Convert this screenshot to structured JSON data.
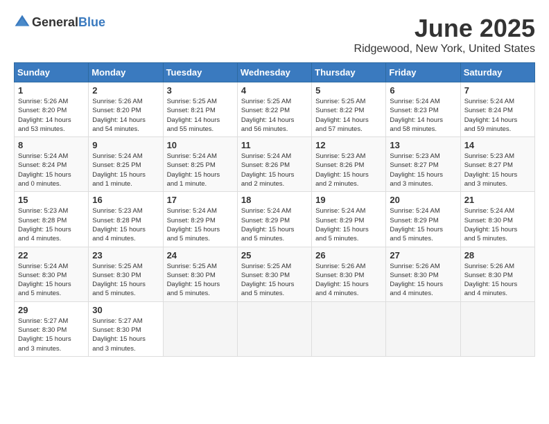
{
  "header": {
    "logo_general": "General",
    "logo_blue": "Blue",
    "title": "June 2025",
    "subtitle": "Ridgewood, New York, United States"
  },
  "days_of_week": [
    "Sunday",
    "Monday",
    "Tuesday",
    "Wednesday",
    "Thursday",
    "Friday",
    "Saturday"
  ],
  "weeks": [
    [
      {
        "day": "1",
        "info": "Sunrise: 5:26 AM\nSunset: 8:20 PM\nDaylight: 14 hours\nand 53 minutes."
      },
      {
        "day": "2",
        "info": "Sunrise: 5:26 AM\nSunset: 8:20 PM\nDaylight: 14 hours\nand 54 minutes."
      },
      {
        "day": "3",
        "info": "Sunrise: 5:25 AM\nSunset: 8:21 PM\nDaylight: 14 hours\nand 55 minutes."
      },
      {
        "day": "4",
        "info": "Sunrise: 5:25 AM\nSunset: 8:22 PM\nDaylight: 14 hours\nand 56 minutes."
      },
      {
        "day": "5",
        "info": "Sunrise: 5:25 AM\nSunset: 8:22 PM\nDaylight: 14 hours\nand 57 minutes."
      },
      {
        "day": "6",
        "info": "Sunrise: 5:24 AM\nSunset: 8:23 PM\nDaylight: 14 hours\nand 58 minutes."
      },
      {
        "day": "7",
        "info": "Sunrise: 5:24 AM\nSunset: 8:24 PM\nDaylight: 14 hours\nand 59 minutes."
      }
    ],
    [
      {
        "day": "8",
        "info": "Sunrise: 5:24 AM\nSunset: 8:24 PM\nDaylight: 15 hours\nand 0 minutes."
      },
      {
        "day": "9",
        "info": "Sunrise: 5:24 AM\nSunset: 8:25 PM\nDaylight: 15 hours\nand 1 minute."
      },
      {
        "day": "10",
        "info": "Sunrise: 5:24 AM\nSunset: 8:25 PM\nDaylight: 15 hours\nand 1 minute."
      },
      {
        "day": "11",
        "info": "Sunrise: 5:24 AM\nSunset: 8:26 PM\nDaylight: 15 hours\nand 2 minutes."
      },
      {
        "day": "12",
        "info": "Sunrise: 5:23 AM\nSunset: 8:26 PM\nDaylight: 15 hours\nand 2 minutes."
      },
      {
        "day": "13",
        "info": "Sunrise: 5:23 AM\nSunset: 8:27 PM\nDaylight: 15 hours\nand 3 minutes."
      },
      {
        "day": "14",
        "info": "Sunrise: 5:23 AM\nSunset: 8:27 PM\nDaylight: 15 hours\nand 3 minutes."
      }
    ],
    [
      {
        "day": "15",
        "info": "Sunrise: 5:23 AM\nSunset: 8:28 PM\nDaylight: 15 hours\nand 4 minutes."
      },
      {
        "day": "16",
        "info": "Sunrise: 5:23 AM\nSunset: 8:28 PM\nDaylight: 15 hours\nand 4 minutes."
      },
      {
        "day": "17",
        "info": "Sunrise: 5:24 AM\nSunset: 8:29 PM\nDaylight: 15 hours\nand 5 minutes."
      },
      {
        "day": "18",
        "info": "Sunrise: 5:24 AM\nSunset: 8:29 PM\nDaylight: 15 hours\nand 5 minutes."
      },
      {
        "day": "19",
        "info": "Sunrise: 5:24 AM\nSunset: 8:29 PM\nDaylight: 15 hours\nand 5 minutes."
      },
      {
        "day": "20",
        "info": "Sunrise: 5:24 AM\nSunset: 8:29 PM\nDaylight: 15 hours\nand 5 minutes."
      },
      {
        "day": "21",
        "info": "Sunrise: 5:24 AM\nSunset: 8:30 PM\nDaylight: 15 hours\nand 5 minutes."
      }
    ],
    [
      {
        "day": "22",
        "info": "Sunrise: 5:24 AM\nSunset: 8:30 PM\nDaylight: 15 hours\nand 5 minutes."
      },
      {
        "day": "23",
        "info": "Sunrise: 5:25 AM\nSunset: 8:30 PM\nDaylight: 15 hours\nand 5 minutes."
      },
      {
        "day": "24",
        "info": "Sunrise: 5:25 AM\nSunset: 8:30 PM\nDaylight: 15 hours\nand 5 minutes."
      },
      {
        "day": "25",
        "info": "Sunrise: 5:25 AM\nSunset: 8:30 PM\nDaylight: 15 hours\nand 5 minutes."
      },
      {
        "day": "26",
        "info": "Sunrise: 5:26 AM\nSunset: 8:30 PM\nDaylight: 15 hours\nand 4 minutes."
      },
      {
        "day": "27",
        "info": "Sunrise: 5:26 AM\nSunset: 8:30 PM\nDaylight: 15 hours\nand 4 minutes."
      },
      {
        "day": "28",
        "info": "Sunrise: 5:26 AM\nSunset: 8:30 PM\nDaylight: 15 hours\nand 4 minutes."
      }
    ],
    [
      {
        "day": "29",
        "info": "Sunrise: 5:27 AM\nSunset: 8:30 PM\nDaylight: 15 hours\nand 3 minutes."
      },
      {
        "day": "30",
        "info": "Sunrise: 5:27 AM\nSunset: 8:30 PM\nDaylight: 15 hours\nand 3 minutes."
      },
      null,
      null,
      null,
      null,
      null
    ]
  ]
}
